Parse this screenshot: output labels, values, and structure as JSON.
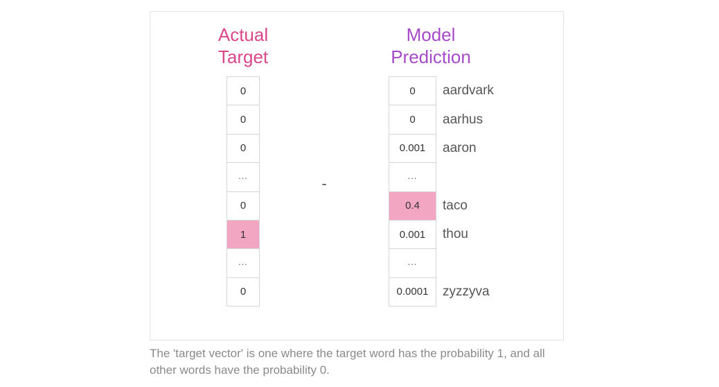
{
  "actual_title": {
    "line1": "Actual",
    "line2": "Target"
  },
  "model_title": {
    "line1": "Model",
    "line2": "Prediction"
  },
  "operator": "-",
  "actual_vector": [
    "0",
    "0",
    "0",
    "...",
    "0",
    "1",
    "...",
    "0"
  ],
  "model_vector": [
    "0",
    "0",
    "0.001",
    "...",
    "0.4",
    "0.001",
    "...",
    "0.0001"
  ],
  "word_labels": [
    "aardvark",
    "aarhus",
    "aaron",
    "",
    "taco",
    "thou",
    "",
    "zyzzyva"
  ],
  "highlight_color": "#f3a6c2",
  "actual_title_color": "#d9478a",
  "model_title_color": "#a64ac9",
  "caption": "The 'target vector' is one where the target word has the probability 1, and all other words have the probability 0."
}
